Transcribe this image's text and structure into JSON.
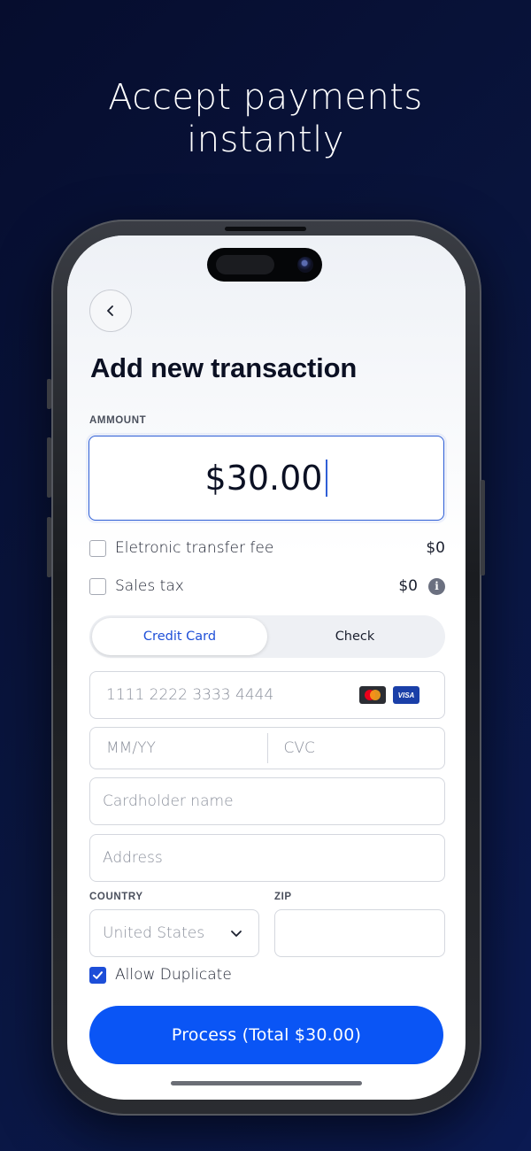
{
  "headline": {
    "line1": "Accept payments",
    "line2": "instantly"
  },
  "screen": {
    "back_icon": "chevron-left-icon",
    "title": "Add new transaction",
    "amount": {
      "label": "AMMOUNT",
      "value": "$30.00"
    },
    "fees": [
      {
        "label": "Eletronic transfer fee",
        "value": "$0",
        "checked": false
      },
      {
        "label": "Sales tax",
        "value": "$0",
        "checked": false,
        "info_icon": "info-icon",
        "info_glyph": "i"
      }
    ],
    "payment_tabs": [
      {
        "label": "Credit Card",
        "active": true
      },
      {
        "label": "Check",
        "active": false
      }
    ],
    "card": {
      "number_placeholder": "1111 2222 3333 4444",
      "brands": [
        "mastercard-icon",
        "visa-icon"
      ],
      "visa_text": "VISA",
      "expiry_placeholder": "MM/YY",
      "cvc_placeholder": "CVC",
      "cardholder_placeholder": "Cardholder name",
      "address_placeholder": "Address"
    },
    "country": {
      "label": "COUNTRY",
      "value": "United States"
    },
    "zip": {
      "label": "ZIP",
      "value": ""
    },
    "allow_duplicate": {
      "label": "Allow Duplicate",
      "checked": true
    },
    "process_button": "Process (Total $30.00)"
  },
  "colors": {
    "accent": "#0a55f5",
    "active_tab_text": "#1e4fd8",
    "background": "#0a1640"
  }
}
